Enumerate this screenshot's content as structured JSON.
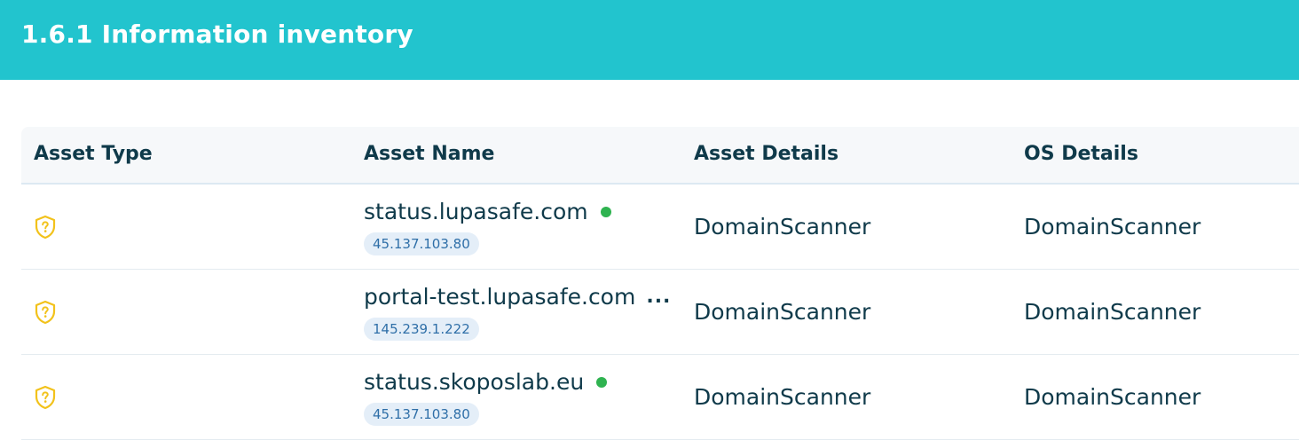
{
  "header": {
    "title": "1.6.1 Information inventory"
  },
  "colors": {
    "header_bg": "#22c4ce",
    "status_online": "#2fb350",
    "shield_icon": "#f2c21b"
  },
  "table": {
    "columns": [
      "Asset Type",
      "Asset Name",
      "Asset Details",
      "OS Details"
    ],
    "rows": [
      {
        "asset_type_icon": "shield-question-icon",
        "asset_name": "status.lupasafe.com",
        "status": "online",
        "ip": "45.137.103.80",
        "asset_details": "DomainScanner",
        "os_details": "DomainScanner"
      },
      {
        "asset_type_icon": "shield-question-icon",
        "asset_name": "portal-test.lupasafe.com",
        "more": "...",
        "ip": "145.239.1.222",
        "asset_details": "DomainScanner",
        "os_details": "DomainScanner"
      },
      {
        "asset_type_icon": "shield-question-icon",
        "asset_name": "status.skoposlab.eu",
        "status": "online",
        "ip": "45.137.103.80",
        "asset_details": "DomainScanner",
        "os_details": "DomainScanner"
      }
    ]
  }
}
